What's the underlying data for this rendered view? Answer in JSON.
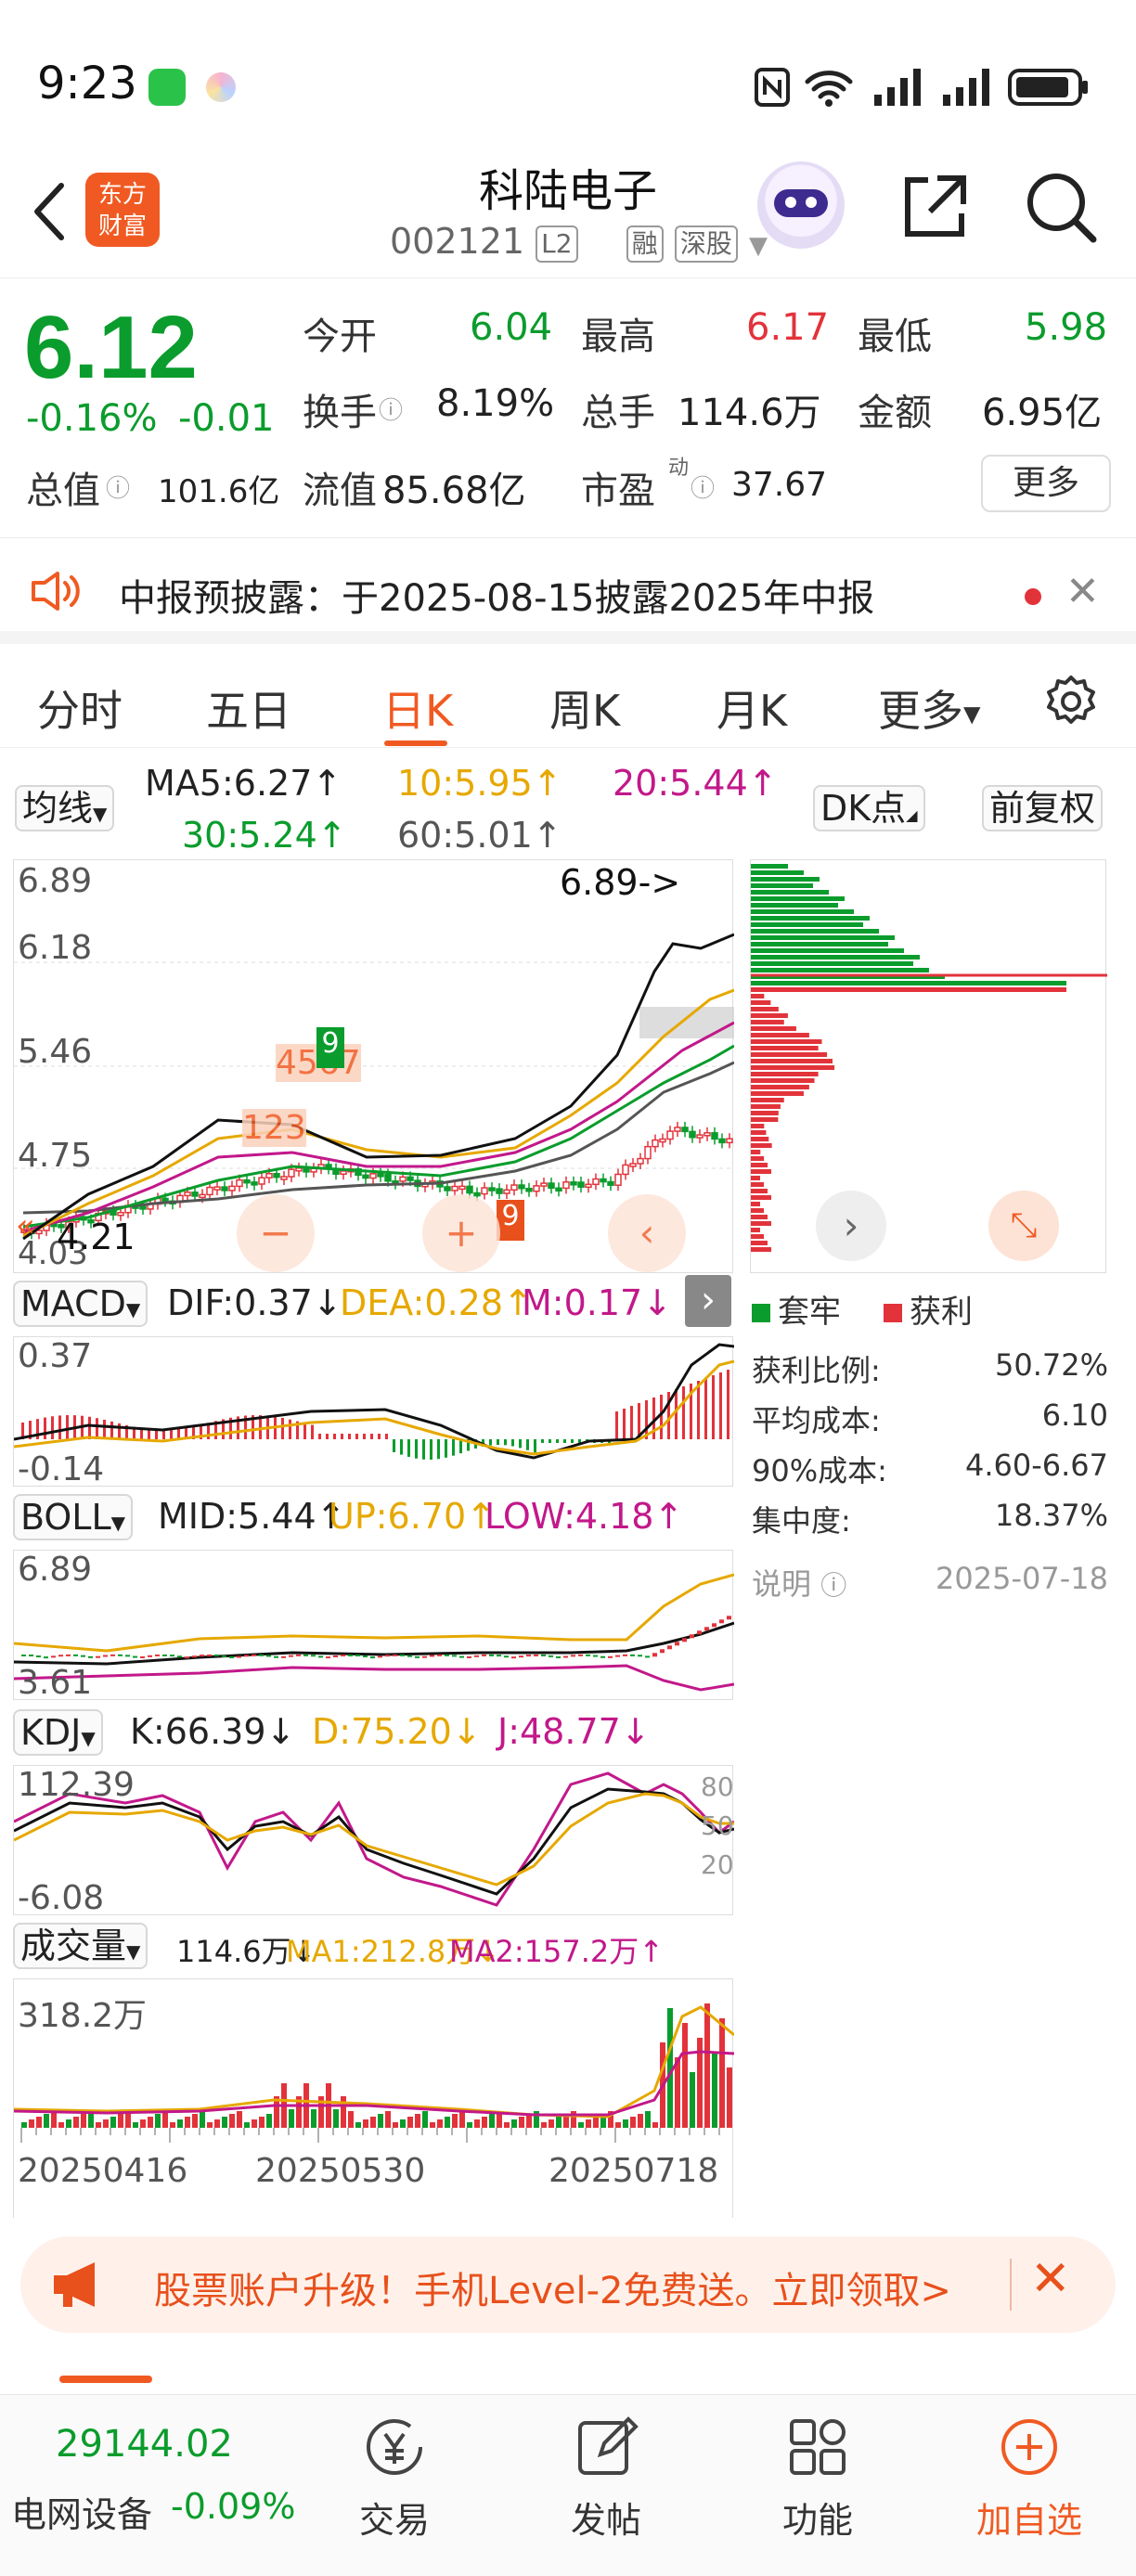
{
  "status_bar": {
    "time": "9:23"
  },
  "header": {
    "stock_name": "科陆电子",
    "stock_code": "002121",
    "level_tag": "L2",
    "tag_margin": "融",
    "tag_market": "深股"
  },
  "quote": {
    "price": "6.12",
    "change_pct": "-0.16%",
    "change_amt": "-0.01",
    "open_label": "今开",
    "open_value": "6.04",
    "high_label": "最高",
    "high_value": "6.17",
    "low_label": "最低",
    "low_value": "5.98",
    "turnover_label": "换手",
    "turnover_value": "8.19%",
    "volume_label": "总手",
    "volume_value": "114.6万",
    "amount_label": "金额",
    "amount_value": "6.95亿",
    "mcap_label": "总值",
    "mcap_value": "101.6亿",
    "float_label": "流值",
    "float_value": "85.68亿",
    "pe_label": "市盈",
    "pe_sup": "动",
    "pe_value": "37.67",
    "more_label": "更多"
  },
  "notice": {
    "text": "中报预披露：于2025-08-15披露2025年中报"
  },
  "period_tabs": [
    {
      "label": "分时"
    },
    {
      "label": "五日"
    },
    {
      "label": "日K"
    },
    {
      "label": "周K"
    },
    {
      "label": "月K"
    },
    {
      "label": "更多"
    }
  ],
  "ma_row": {
    "selector": "均线",
    "ma5": "MA5:6.27↑",
    "ma10": "10:5.95↑",
    "ma20": "20:5.44↑",
    "ma30": "30:5.24↑",
    "ma60": "60:5.01↑",
    "dk_label": "DK点",
    "adjust_label": "前复权"
  },
  "kline": {
    "y_labels": [
      "6.89",
      "6.18",
      "5.46",
      "4.75",
      "4.03"
    ],
    "max_marker": "6.89->",
    "min_marker": "4.21",
    "tick_numbers": [
      "4",
      "5",
      "6",
      "7",
      "8",
      "9",
      "1",
      "2",
      "3"
    ]
  },
  "chart_data": [
    {
      "type": "line",
      "title": "MACD",
      "y_labels": [
        "0.37",
        "-0.14"
      ],
      "series": [
        {
          "name": "DIF",
          "last": 0.37
        },
        {
          "name": "DEA",
          "last": 0.28
        },
        {
          "name": "M",
          "last": 0.17
        }
      ]
    },
    {
      "type": "line",
      "title": "BOLL",
      "y_labels": [
        "6.89",
        "3.61"
      ],
      "series": [
        {
          "name": "MID",
          "last": 5.44
        },
        {
          "name": "UP",
          "last": 6.7
        },
        {
          "name": "LOW",
          "last": 4.18
        }
      ]
    },
    {
      "type": "line",
      "title": "KDJ",
      "y_labels": [
        "112.39",
        "-6.08"
      ],
      "ref_levels": [
        "80",
        "50",
        "20"
      ],
      "series": [
        {
          "name": "K",
          "last": 66.39
        },
        {
          "name": "D",
          "last": 75.2
        },
        {
          "name": "J",
          "last": 48.77
        }
      ]
    },
    {
      "type": "bar",
      "title": "成交量",
      "y_max_label": "318.2万",
      "x_labels": [
        "20250416",
        "20250530",
        "20250718"
      ],
      "series": [
        {
          "name": "VOL",
          "last_label": "114.6万"
        },
        {
          "name": "MA1",
          "last_label": "212.8万"
        },
        {
          "name": "MA2",
          "last_label": "157.2万"
        }
      ]
    }
  ],
  "indicators": {
    "macd": {
      "selector": "MACD",
      "dif": "DIF:0.37↓",
      "dea": "DEA:0.28↑",
      "m": "M:0.17↓",
      "y_top": "0.37",
      "y_bot": "-0.14"
    },
    "boll": {
      "selector": "BOLL",
      "mid": "MID:5.44↑",
      "up": "UP:6.70↑",
      "low": "LOW:4.18↑",
      "y_top": "6.89",
      "y_bot": "3.61"
    },
    "kdj": {
      "selector": "KDJ",
      "k": "K:66.39↓",
      "d": "D:75.20↓",
      "j": "J:48.77↓",
      "y_top": "112.39",
      "y_bot": "-6.08",
      "lvl80": "80",
      "lvl50": "50",
      "lvl20": "20"
    },
    "vol": {
      "selector": "成交量",
      "vol": "114.6万↓",
      "ma1": "MA1:212.8万↓",
      "ma2": "MA2:157.2万↑",
      "y_top": "318.2万",
      "x1": "20250416",
      "x2": "20250530",
      "x3": "20250718"
    }
  },
  "chips": {
    "legend_trapped": "套牢",
    "legend_profit": "获利",
    "rows": [
      {
        "label": "获利比例:",
        "value": "50.72%"
      },
      {
        "label": "平均成本:",
        "value": "6.10"
      },
      {
        "label": "90%成本:",
        "value": "4.60-6.67"
      },
      {
        "label": "集中度:",
        "value": "18.37%"
      }
    ],
    "note_label": "说明",
    "date": "2025-07-18"
  },
  "promo": {
    "text": "股票账户升级！手机Level-2免费送。立即领取>"
  },
  "bottom_bar": {
    "index_value": "29144.02",
    "index_name": "电网设备",
    "index_change": "-0.09%",
    "trade_label": "交易",
    "post_label": "发帖",
    "feature_label": "功能",
    "watch_label": "加自选"
  },
  "colors": {
    "up": "#e2333b",
    "down": "#0a9c2c",
    "accent": "#f05a22"
  }
}
